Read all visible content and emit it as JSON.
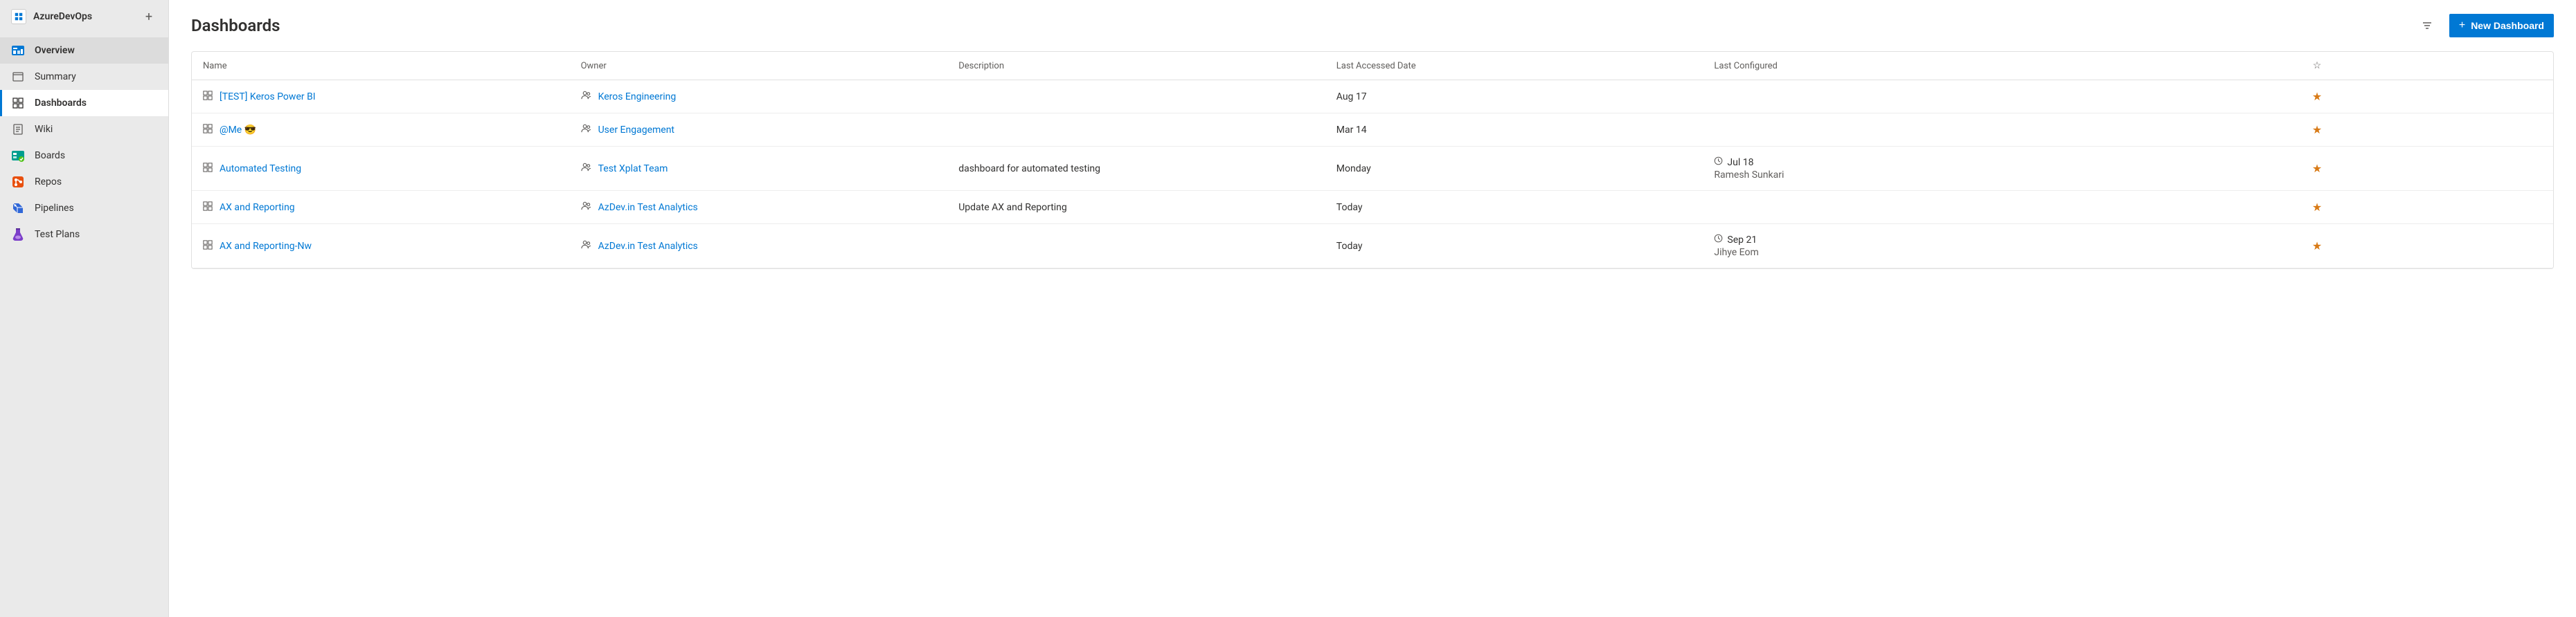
{
  "project": {
    "name": "AzureDevOps"
  },
  "sidebar": {
    "items": [
      {
        "label": "Overview",
        "kind": "overview"
      },
      {
        "label": "Summary",
        "kind": "summary"
      },
      {
        "label": "Dashboards",
        "kind": "dashboards"
      },
      {
        "label": "Wiki",
        "kind": "wiki"
      },
      {
        "label": "Boards",
        "kind": "boards"
      },
      {
        "label": "Repos",
        "kind": "repos"
      },
      {
        "label": "Pipelines",
        "kind": "pipelines"
      },
      {
        "label": "Test Plans",
        "kind": "testplans"
      }
    ]
  },
  "page": {
    "title": "Dashboards",
    "new_button": "New Dashboard"
  },
  "table": {
    "headers": {
      "name": "Name",
      "owner": "Owner",
      "description": "Description",
      "last_accessed": "Last Accessed Date",
      "last_configured": "Last Configured"
    },
    "rows": [
      {
        "name": "[TEST] Keros Power BI",
        "owner": "Keros Engineering",
        "description": "",
        "last_accessed": "Aug 17",
        "configured_date": "",
        "configured_by": "",
        "starred": true
      },
      {
        "name": "@Me 😎",
        "owner": "User Engagement",
        "description": "",
        "last_accessed": "Mar 14",
        "configured_date": "",
        "configured_by": "",
        "starred": true
      },
      {
        "name": "Automated Testing",
        "owner": "Test Xplat Team",
        "description": "dashboard for automated testing",
        "last_accessed": "Monday",
        "configured_date": "Jul 18",
        "configured_by": "Ramesh Sunkari",
        "starred": true
      },
      {
        "name": "AX and Reporting",
        "owner": "AzDev.in Test Analytics",
        "description": "Update AX and Reporting",
        "last_accessed": "Today",
        "configured_date": "",
        "configured_by": "",
        "starred": true
      },
      {
        "name": "AX and Reporting-Nw",
        "owner": "AzDev.in Test Analytics",
        "description": "",
        "last_accessed": "Today",
        "configured_date": "Sep 21",
        "configured_by": "Jihye Eom",
        "starred": true
      }
    ]
  }
}
